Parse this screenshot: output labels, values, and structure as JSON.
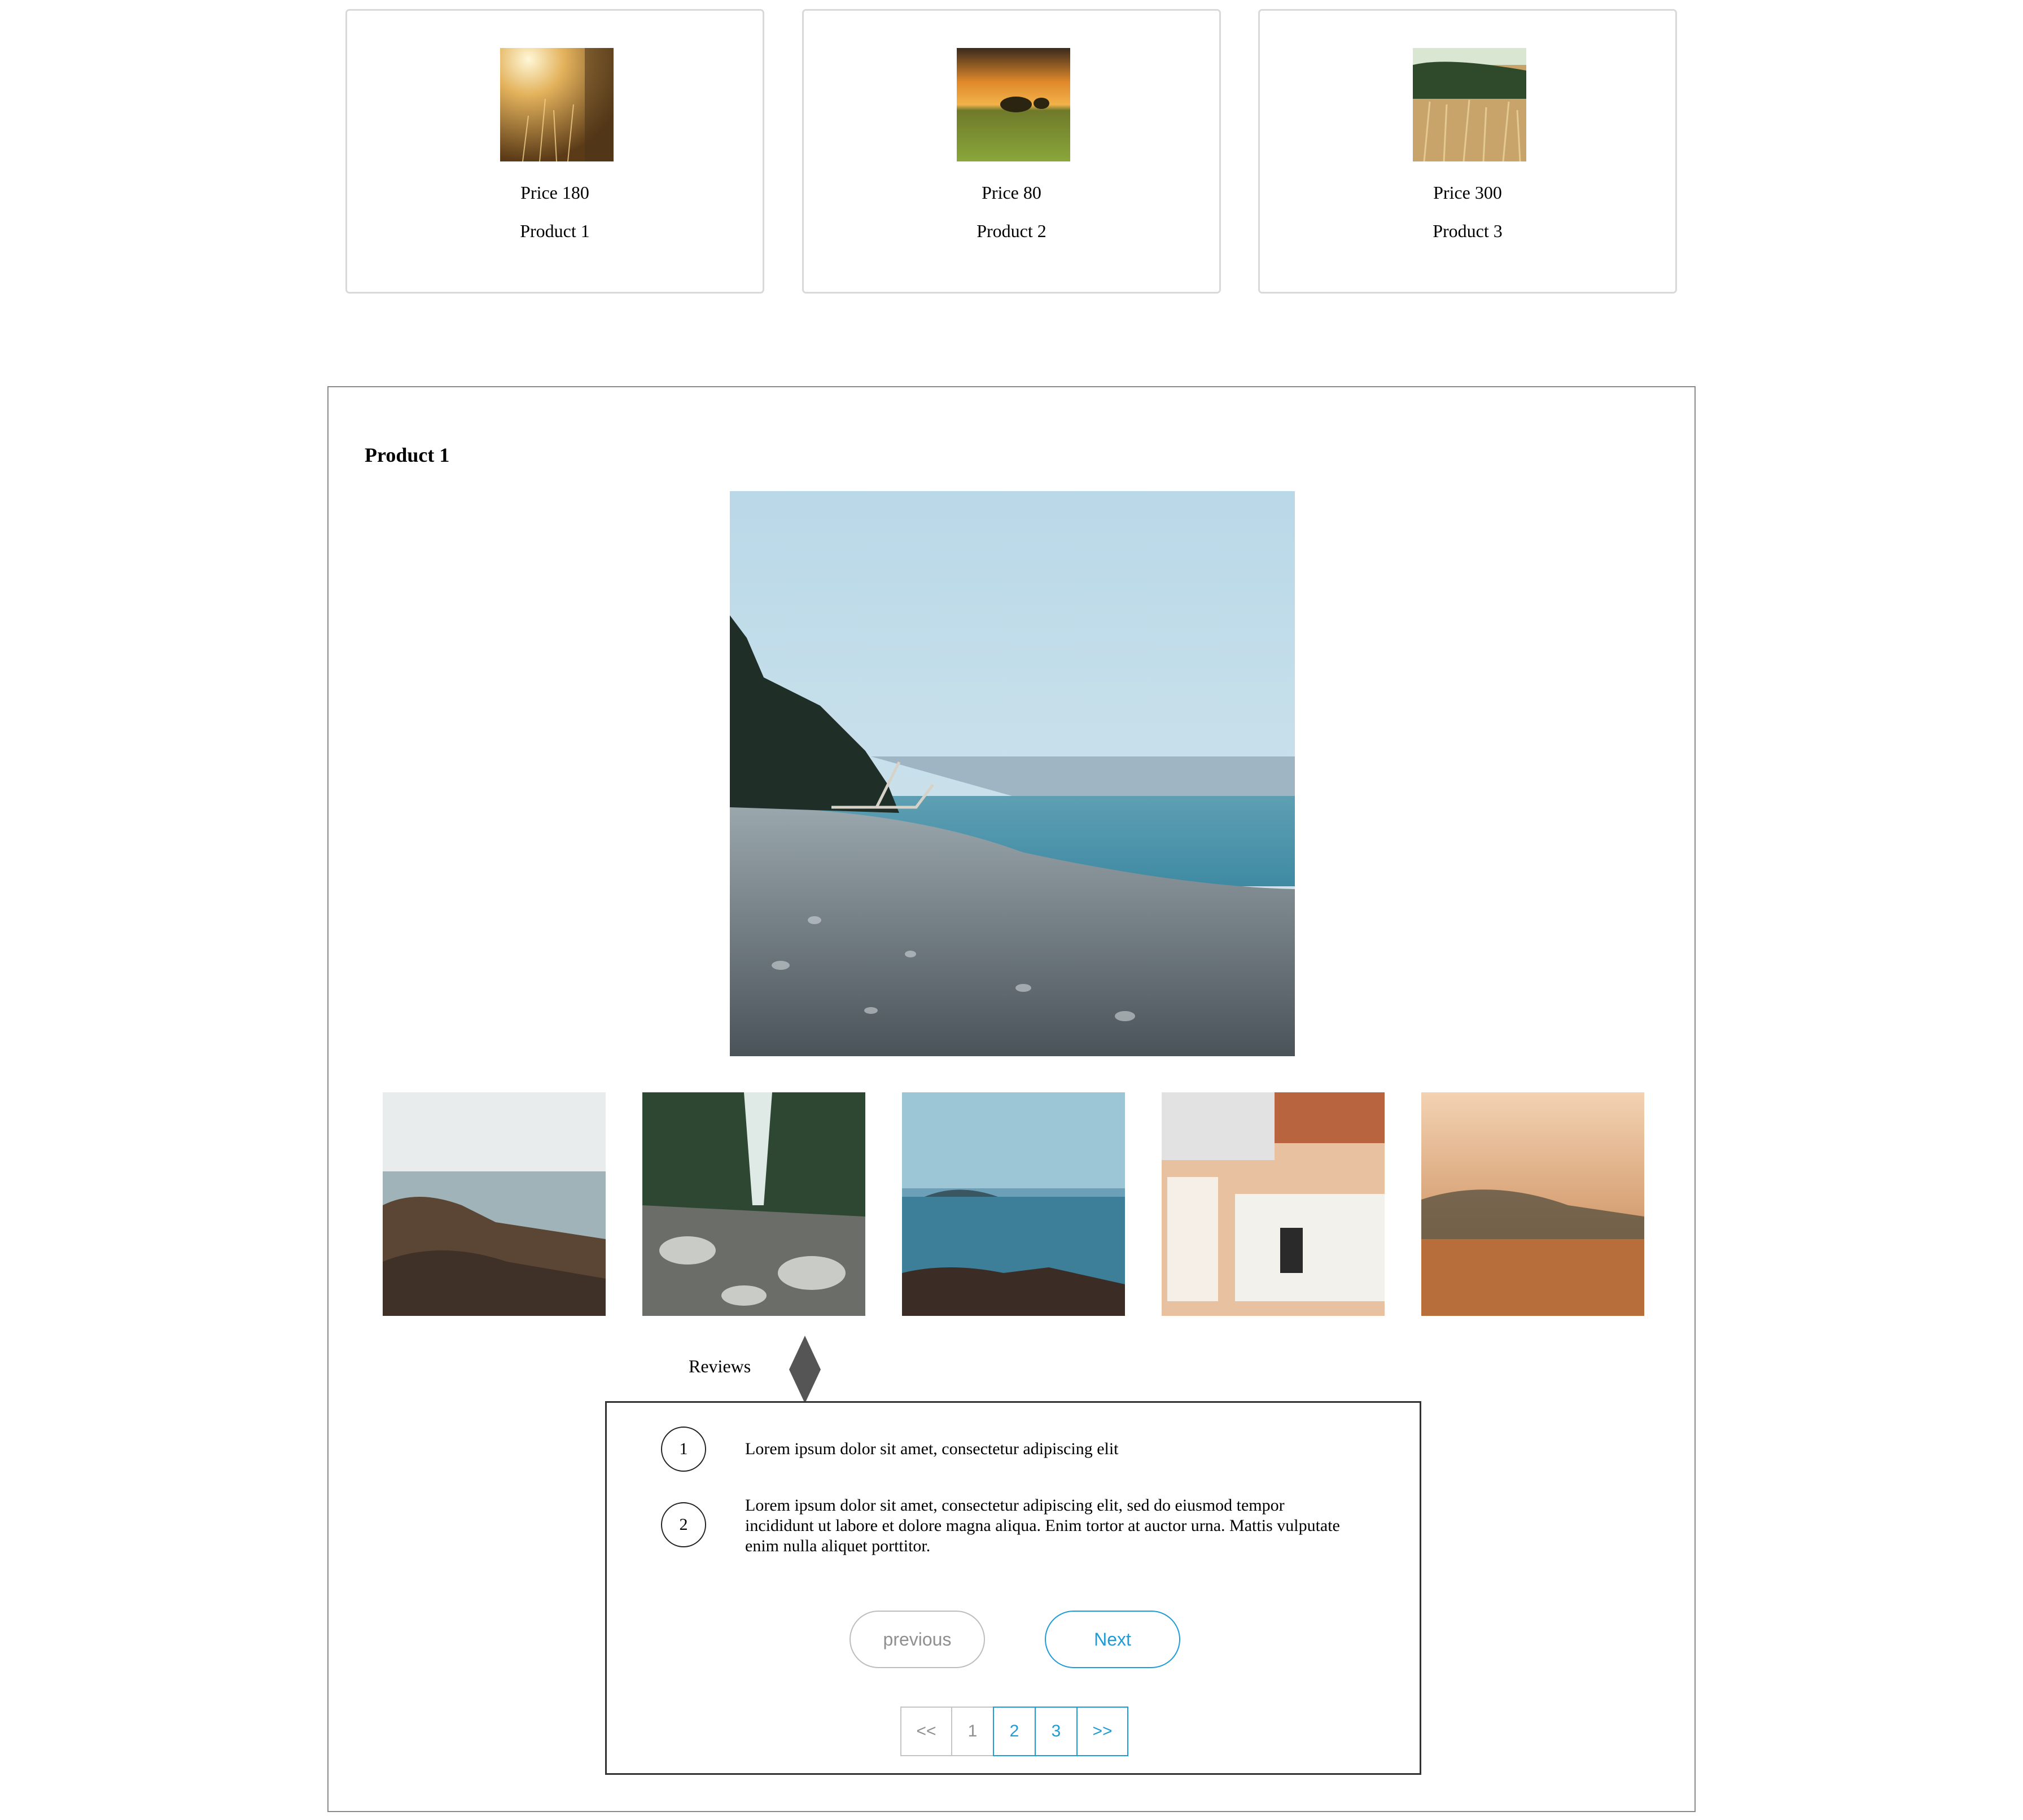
{
  "products": [
    {
      "price": "Price 180",
      "name": "Product 1",
      "thumb_icon": "sunlit-grass-photo"
    },
    {
      "price": "Price 80",
      "name": "Product 2",
      "thumb_icon": "sunset-field-photo"
    },
    {
      "price": "Price 300",
      "name": "Product 3",
      "thumb_icon": "wheat-photo"
    }
  ],
  "detail": {
    "title": "Product 1",
    "main_image": "beach-shore-photo",
    "thumbnails": [
      "rocky-coast-photo",
      "waterfall-photo",
      "lake-rocks-photo",
      "desk-workspace-photo",
      "misty-cliff-photo"
    ]
  },
  "reviews": {
    "label": "Reviews",
    "items": [
      {
        "number": "1",
        "text": "Lorem ipsum dolor sit amet, consectetur adipiscing elit"
      },
      {
        "number": "2",
        "text": "Lorem ipsum dolor sit amet, consectetur adipiscing elit, sed do eiusmod tempor incididunt ut labore et dolore magna aliqua. Enim tortor at auctor urna. Mattis vulputate enim nulla aliquet porttitor."
      }
    ],
    "previous_label": "previous",
    "next_label": "Next",
    "pagination": {
      "first": "<<",
      "pages": [
        "1",
        "2",
        "3"
      ],
      "last": ">>",
      "current_page": "1"
    }
  },
  "colors": {
    "accent": "#1f9bd6",
    "border": "#d9d9d9",
    "disabled": "#8f8f8f"
  }
}
